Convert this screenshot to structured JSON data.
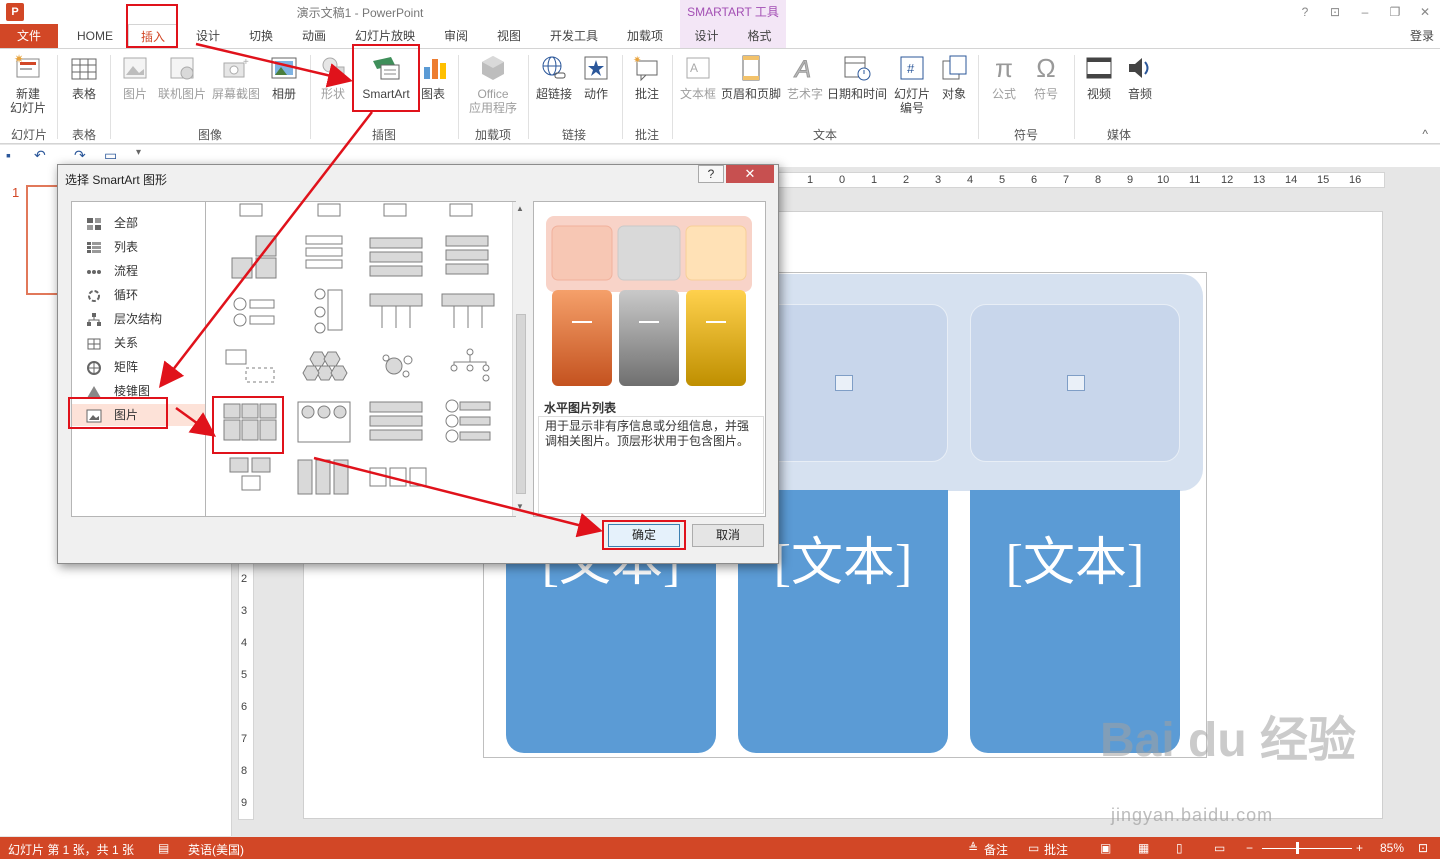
{
  "titlebar": {
    "app_icon": "P",
    "title": "演示文稿1 - PowerPoint",
    "context_title": "SMARTART 工具",
    "help": "?",
    "min": "–",
    "restore": "❐",
    "close": "✕"
  },
  "tabs": {
    "file": "文件",
    "home": "HOME",
    "insert": "插入",
    "design": "设计",
    "transitions": "切换",
    "animations": "动画",
    "slideshow": "幻灯片放映",
    "review": "审阅",
    "view": "视图",
    "developer": "开发工具",
    "addins": "加载项",
    "sa_design": "设计",
    "sa_format": "格式",
    "login": "登录"
  },
  "ribbon": {
    "new_slide": "新建\n幻灯片",
    "table": "表格",
    "picture": "图片",
    "online_picture": "联机图片",
    "screenshot": "屏幕截图",
    "album": "相册",
    "shapes": "形状",
    "smartart": "SmartArt",
    "chart": "图表",
    "office_apps": "Office\n应用程序",
    "hyperlink": "超链接",
    "action": "动作",
    "comment": "批注",
    "textbox": "文本框",
    "header_footer": "页眉和页脚",
    "wordart": "艺术字",
    "datetime": "日期和时间",
    "slide_number": "幻灯片\n编号",
    "object": "对象",
    "equation": "公式",
    "symbol": "符号",
    "video": "视频",
    "audio": "音频",
    "groups": {
      "slides": "幻灯片",
      "tables": "表格",
      "images": "图像",
      "illustrations": "插图",
      "addins": "加载项",
      "links": "链接",
      "comments": "批注",
      "text": "文本",
      "symbols": "符号",
      "media": "媒体"
    }
  },
  "slides_pane": {
    "slide_number": "1"
  },
  "ruler": {
    "h_labels": [
      "1",
      "0",
      "1",
      "2",
      "3",
      "4",
      "5",
      "6",
      "7",
      "8",
      "9",
      "10",
      "11",
      "12",
      "13",
      "14",
      "15",
      "16"
    ],
    "v_labels": [
      "2",
      "3",
      "4",
      "5",
      "6",
      "7",
      "8",
      "9"
    ]
  },
  "slide": {
    "text_placeholder": "[文本]"
  },
  "dialog": {
    "title": "选择 SmartArt 图形",
    "help": "?",
    "close": "✕",
    "categories": [
      "全部",
      "列表",
      "流程",
      "循环",
      "层次结构",
      "关系",
      "矩阵",
      "棱锥图",
      "图片"
    ],
    "selected_category": "图片",
    "preview_name": "水平图片列表",
    "preview_description": "用于显示非有序信息或分组信息，并强调相关图片。顶层形状用于包含图片。",
    "ok": "确定",
    "cancel": "取消"
  },
  "statusbar": {
    "slide_info": "幻灯片 第 1 张，共 1 张",
    "language": "英语(美国)",
    "notes": "备注",
    "comments": "批注",
    "zoom": "85%"
  },
  "watermark": {
    "brand": "Bai du 经验",
    "url": "jingyan.baidu.com"
  },
  "colors": {
    "accent": "#d24726",
    "highlight": "#e0121b",
    "smartart_blue": "#5b9bd5",
    "smartart_light": "#d6e1f0"
  }
}
